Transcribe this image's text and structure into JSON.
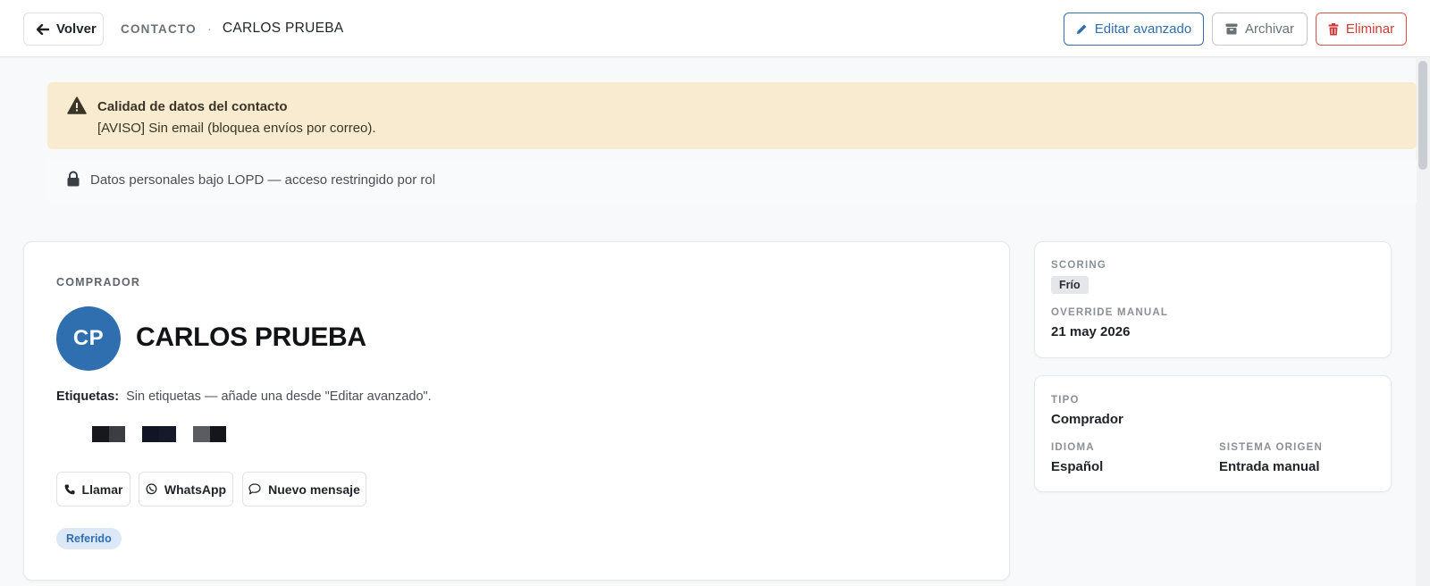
{
  "header": {
    "back_label": "Volver",
    "breadcrumb_section": "CONTACTO",
    "breadcrumb_separator": "·",
    "breadcrumb_current": "CARLOS PRUEBA",
    "actions": {
      "edit_label": "Editar avanzado",
      "archive_label": "Archivar",
      "delete_label": "Eliminar"
    }
  },
  "alerts": {
    "warning": {
      "title": "Calidad de datos del contacto",
      "text": "[AVISO] Sin email (bloquea envíos por correo)."
    },
    "privacy_notice": "Datos personales bajo LOPD — acceso restringido por rol"
  },
  "contact": {
    "kicker": "COMPRADOR",
    "initials": "CP",
    "name": "CARLOS PRUEBA",
    "tags_label": "Etiquetas:",
    "tags_empty_text": "Sin etiquetas — añade una desde \"Editar avanzado\".",
    "actions": {
      "call_label": "Llamar",
      "whatsapp_label": "WhatsApp",
      "message_label": "Nuevo mensaje"
    },
    "source_badge": "Referido"
  },
  "scoring_card": {
    "scoring_label": "SCORING",
    "scoring_value": "Frío",
    "override_label": "OVERRIDE MANUAL",
    "override_value": "21 may 2026"
  },
  "type_card": {
    "type_label": "TIPO",
    "type_value": "Comprador",
    "language_label": "IDIOMA",
    "language_value": "Español",
    "origin_label": "SISTEMA ORIGEN",
    "origin_value": "Entrada manual"
  },
  "icons": {
    "back": "arrow-left-icon",
    "edit": "pencil-icon",
    "archive": "archive-box-icon",
    "delete": "trash-icon",
    "warning": "warning-triangle-icon",
    "lock": "lock-icon",
    "call": "phone-icon",
    "whatsapp": "whatsapp-icon",
    "message": "chat-bubble-icon"
  },
  "colors": {
    "primary": "#2f6fb0",
    "danger": "#d03a36",
    "warning_bg": "#f8ebd0",
    "avatar_bg": "#2f6fb0",
    "badge_bg": "#dce8f7"
  }
}
